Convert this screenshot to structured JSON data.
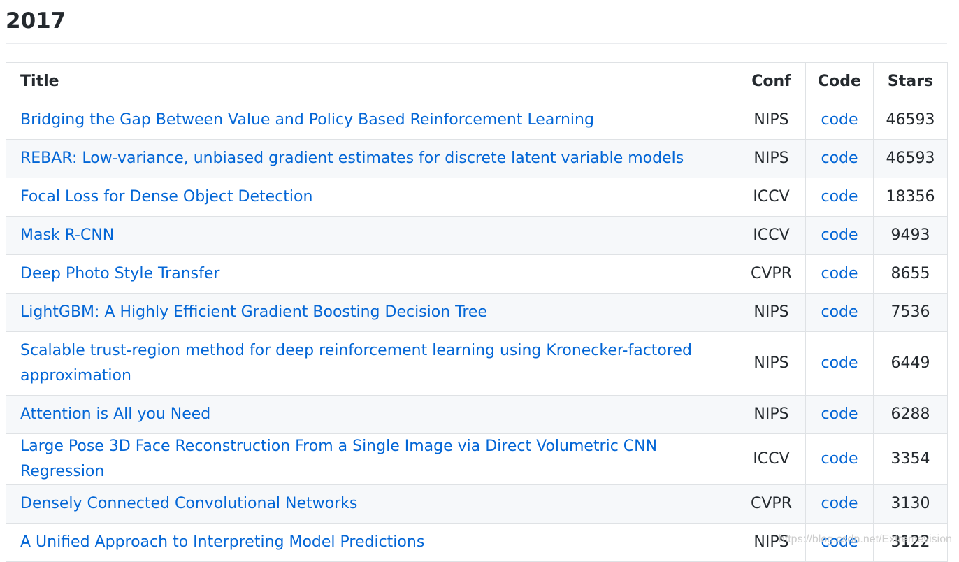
{
  "heading": "2017",
  "table": {
    "headers": {
      "title": "Title",
      "conf": "Conf",
      "code": "Code",
      "stars": "Stars"
    },
    "rows": [
      {
        "title": "Bridging the Gap Between Value and Policy Based Reinforcement Learning",
        "conf": "NIPS",
        "code": "code",
        "stars": "46593"
      },
      {
        "title": "REBAR: Low-variance, unbiased gradient estimates for discrete latent variable models",
        "conf": "NIPS",
        "code": "code",
        "stars": "46593"
      },
      {
        "title": "Focal Loss for Dense Object Detection",
        "conf": "ICCV",
        "code": "code",
        "stars": "18356"
      },
      {
        "title": "Mask R-CNN",
        "conf": "ICCV",
        "code": "code",
        "stars": "9493"
      },
      {
        "title": "Deep Photo Style Transfer",
        "conf": "CVPR",
        "code": "code",
        "stars": "8655"
      },
      {
        "title": "LightGBM: A Highly Efficient Gradient Boosting Decision Tree",
        "conf": "NIPS",
        "code": "code",
        "stars": "7536"
      },
      {
        "title": "Scalable trust-region method for deep reinforcement learning using Kronecker-factored approximation",
        "conf": "NIPS",
        "code": "code",
        "stars": "6449"
      },
      {
        "title": "Attention is All you Need",
        "conf": "NIPS",
        "code": "code",
        "stars": "6288"
      },
      {
        "title": "Large Pose 3D Face Reconstruction From a Single Image via Direct Volumetric CNN Regression",
        "conf": "ICCV",
        "code": "code",
        "stars": "3354"
      },
      {
        "title": "Densely Connected Convolutional Networks",
        "conf": "CVPR",
        "code": "code",
        "stars": "3130"
      },
      {
        "title": "A Unified Approach to Interpreting Model Predictions",
        "conf": "NIPS",
        "code": "code",
        "stars": "3122"
      }
    ]
  },
  "watermark": "https://blog.csdn.net/Extremevision",
  "colors": {
    "link": "#0366d6",
    "text": "#24292e",
    "border": "#dfe2e5",
    "stripe": "#f6f8fa"
  }
}
